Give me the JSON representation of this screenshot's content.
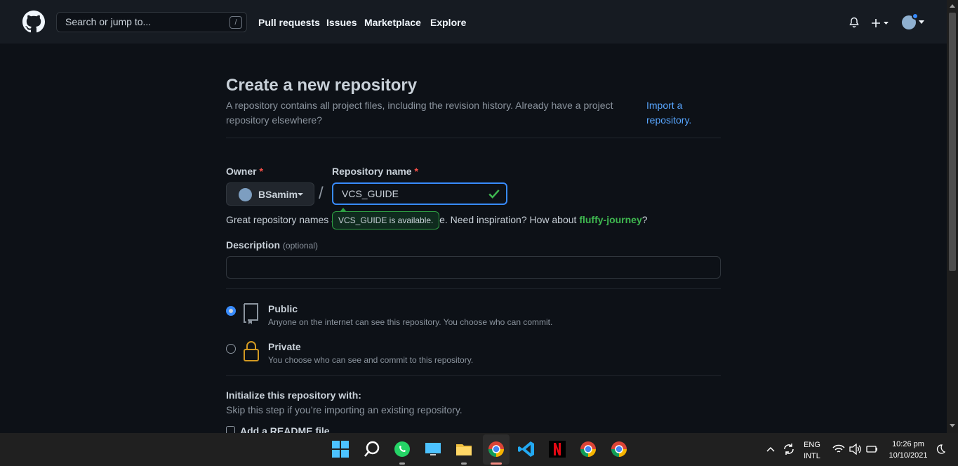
{
  "header": {
    "search_placeholder": "Search or jump to...",
    "search_shortcut": "/",
    "nav": [
      "Pull requests",
      "Issues",
      "Marketplace",
      "Explore"
    ]
  },
  "page": {
    "title": "Create a new repository",
    "subtitle": "A repository contains all project files, including the revision history. Already have a project repository elsewhere?",
    "import_link": "Import a repository."
  },
  "form": {
    "owner_label": "Owner",
    "required_mark": "*",
    "owner_value": "BSamim",
    "separator": "/",
    "repo_label": "Repository name",
    "repo_value": "VCS_GUIDE",
    "availability_tooltip": "VCS_GUIDE is available.",
    "hint_prefix": "Great repository names a",
    "hint_suffix": "le. Need inspiration? How about ",
    "hint_suggestion": "fluffy-journey",
    "hint_end": "?",
    "description_label": "Description",
    "description_optional": "(optional)",
    "description_value": "",
    "visibility": [
      {
        "label": "Public",
        "desc": "Anyone on the internet can see this repository. You choose who can commit.",
        "selected": true
      },
      {
        "label": "Private",
        "desc": "You choose who can see and commit to this repository.",
        "selected": false
      }
    ],
    "init_title": "Initialize this repository with:",
    "init_sub": "Skip this step if you’re importing an existing repository.",
    "readme_label": "Add a README file"
  },
  "taskbar": {
    "lang_top": "ENG",
    "lang_bottom": "INTL",
    "time": "10:26 pm",
    "date": "10/10/2021"
  },
  "colors": {
    "accent": "#388bfd",
    "success": "#3fb950",
    "danger": "#f85149",
    "header_bg": "#161b22",
    "page_bg": "#0d1117"
  }
}
